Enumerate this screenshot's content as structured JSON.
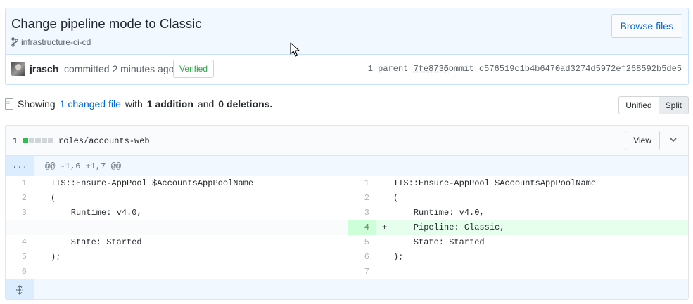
{
  "commit": {
    "title": "Change pipeline mode to Classic",
    "branch": "infrastructure-ci-cd",
    "browse_label": "Browse files",
    "author": "jrasch",
    "committed_text": "committed 2 minutes ago",
    "verified_label": "Verified",
    "parent_label": "1 parent",
    "parent_sha": "7fe8735",
    "commit_label": "commit",
    "commit_sha": "c576519c1b4b6470ad3274d5972ef268592b5de5"
  },
  "summary": {
    "showing": "Showing",
    "changed_files": "1 changed file",
    "with": "with",
    "additions": "1 addition",
    "and": "and",
    "deletions": "0 deletions.",
    "view_modes": [
      "Unified",
      "Split"
    ],
    "active_view": "Split"
  },
  "file": {
    "change_count": "1",
    "path": "roles/accounts-web",
    "view_label": "View",
    "expand_label": "...",
    "hunk_header": "@@ -1,6 +1,7 @@",
    "rows": [
      {
        "left_num": "1",
        "left_code": "IIS::Ensure-AppPool $AccountsAppPoolName",
        "right_num": "1",
        "right_code": "IIS::Ensure-AppPool $AccountsAppPoolName"
      },
      {
        "left_num": "2",
        "left_code": "(",
        "right_num": "2",
        "right_code": "("
      },
      {
        "left_num": "3",
        "left_code": "    Runtime: v4.0,",
        "right_num": "3",
        "right_code": "    Runtime: v4.0,"
      },
      {
        "left_num": "",
        "left_code": "",
        "right_num": "4",
        "right_code": "    Pipeline: Classic,",
        "right_marker": "+"
      },
      {
        "left_num": "4",
        "left_code": "    State: Started",
        "right_num": "5",
        "right_code": "    State: Started"
      },
      {
        "left_num": "5",
        "left_code": ");",
        "right_num": "6",
        "right_code": ");"
      },
      {
        "left_num": "6",
        "left_code": "",
        "right_num": "7",
        "right_code": ""
      }
    ]
  },
  "colors": {
    "link": "#0366d6",
    "verified": "#28a745",
    "addition_bg": "#e6ffed",
    "addition_num_bg": "#cdffd8",
    "hunk_bg": "#f1f8ff"
  },
  "icons": [
    "git-branch-icon",
    "file-diff-icon",
    "chevron-down-icon",
    "unfold-icon",
    "mouse-cursor-icon"
  ]
}
